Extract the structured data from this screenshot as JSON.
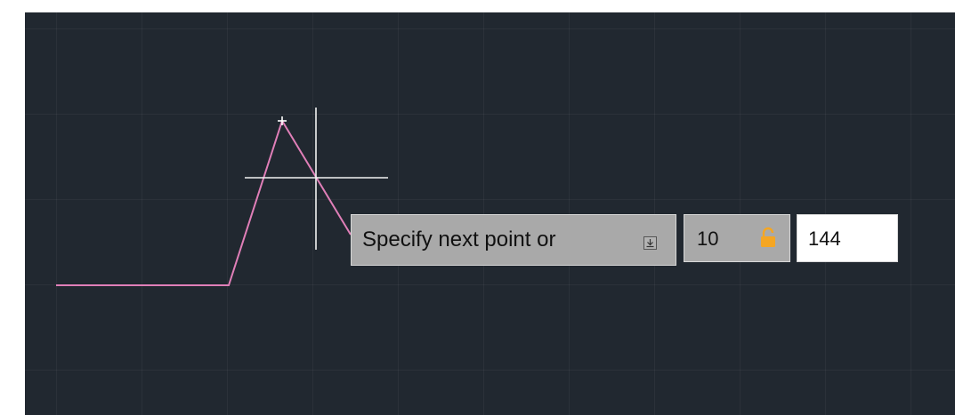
{
  "prompt": {
    "text": "Specify next point or"
  },
  "distance": {
    "value": "10",
    "lock_icon": "unlocked-padlock-icon"
  },
  "angle": {
    "value": "144"
  },
  "icons": {
    "expand": "down-arrow-options-icon",
    "cursor": "crosshair-cursor-icon",
    "vertex": "vertex-marker-icon"
  },
  "colors": {
    "canvas_background": "#212830",
    "polyline": "#e07fb8",
    "crosshair": "#ffffff",
    "prompt_background": "#a9a9a9",
    "lock": "#f5a623"
  }
}
